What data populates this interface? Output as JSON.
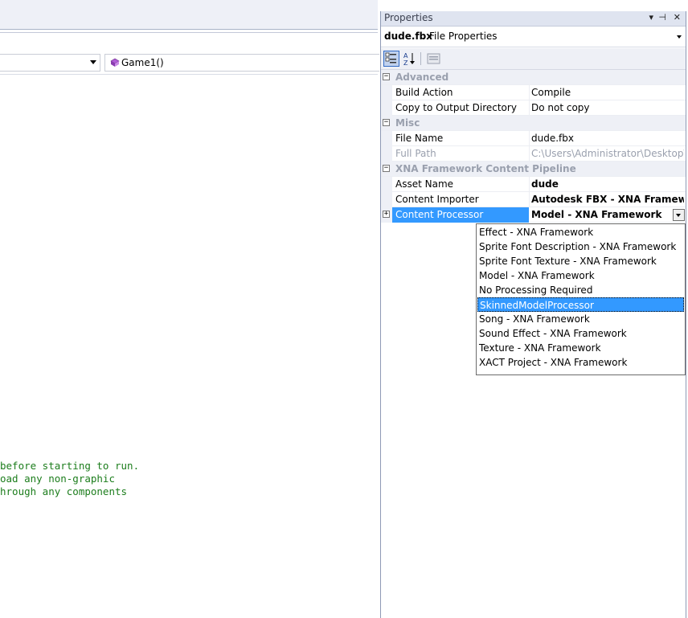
{
  "editor": {
    "member_combo": {
      "label": "Game1()"
    },
    "code_lines": [
      "before starting to run.",
      "oad any non-graphic",
      "hrough any components"
    ]
  },
  "properties": {
    "title": "Properties",
    "title_buttons": [
      "▾",
      "⊣",
      "✕"
    ],
    "file_selector": {
      "name": "dude.fbx",
      "kind": "File Properties"
    },
    "categories": [
      {
        "label": "Advanced",
        "rows": [
          {
            "name": "Build Action",
            "value": "Compile"
          },
          {
            "name": "Copy to Output Directory",
            "value": "Do not copy"
          }
        ]
      },
      {
        "label": "Misc",
        "rows": [
          {
            "name": "File Name",
            "value": "dude.fbx"
          },
          {
            "name": "Full Path",
            "value": "C:\\Users\\Administrator\\Desktop\\"
          }
        ]
      },
      {
        "label": "XNA Framework Content Pipeline",
        "rows": [
          {
            "name": "Asset Name",
            "value": "dude"
          },
          {
            "name": "Content Importer",
            "value": "Autodesk FBX - XNA Framework"
          },
          {
            "name": "Content Processor",
            "value": "Model - XNA Framework"
          }
        ]
      }
    ],
    "dropdown_options": [
      "Effect - XNA Framework",
      "Sprite Font Description - XNA Framework",
      "Sprite Font Texture - XNA Framework",
      "Model - XNA Framework",
      "No Processing Required",
      "SkinnedModelProcessor",
      "Song - XNA Framework",
      "Sound Effect - XNA Framework",
      "Texture - XNA Framework",
      "XACT Project - XNA Framework"
    ],
    "dropdown_selected": "SkinnedModelProcessor"
  },
  "colors": {
    "selection": "#3399ff",
    "code_comment": "#1c7d1c",
    "category_text": "#9aa0ae"
  }
}
